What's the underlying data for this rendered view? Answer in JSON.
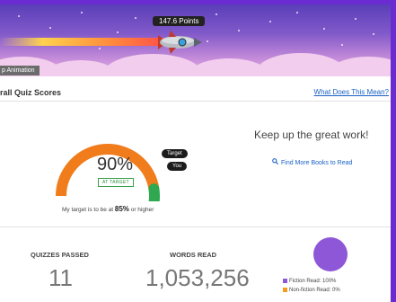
{
  "banner": {
    "points_label": "147.6 Points",
    "animation_toggle": "p Animation"
  },
  "scores": {
    "title": "rall Quiz Scores",
    "help_link": "What Does This Mean?",
    "percent": "90%",
    "status_badge": "AT TARGET",
    "target_tag": "Target",
    "you_tag": "You",
    "caption_prefix": "My target is to be at ",
    "caption_value": "85%",
    "caption_suffix": " or higher",
    "score_fraction": 0.9,
    "target_fraction": 0.85,
    "encouragement": "Keep up the great work!",
    "find_books_link": "Find More Books to Read"
  },
  "stats": {
    "quizzes_label": "QUIZZES PASSED",
    "quizzes_value": "11",
    "words_label": "WORDS READ",
    "words_value": "1,053,256",
    "legend": [
      {
        "label": "Fiction Read: 100%",
        "color": "#8e57d8"
      },
      {
        "label": "Non-fiction Read: 0%",
        "color": "#f39c1e"
      }
    ]
  },
  "colors": {
    "accent_purple": "#6a2bd0",
    "gauge_orange": "#f07c1c",
    "gauge_green": "#2fa84f",
    "link_blue": "#1a62c7"
  },
  "icons": {
    "rocket": "rocket-icon",
    "search": "search-icon"
  }
}
